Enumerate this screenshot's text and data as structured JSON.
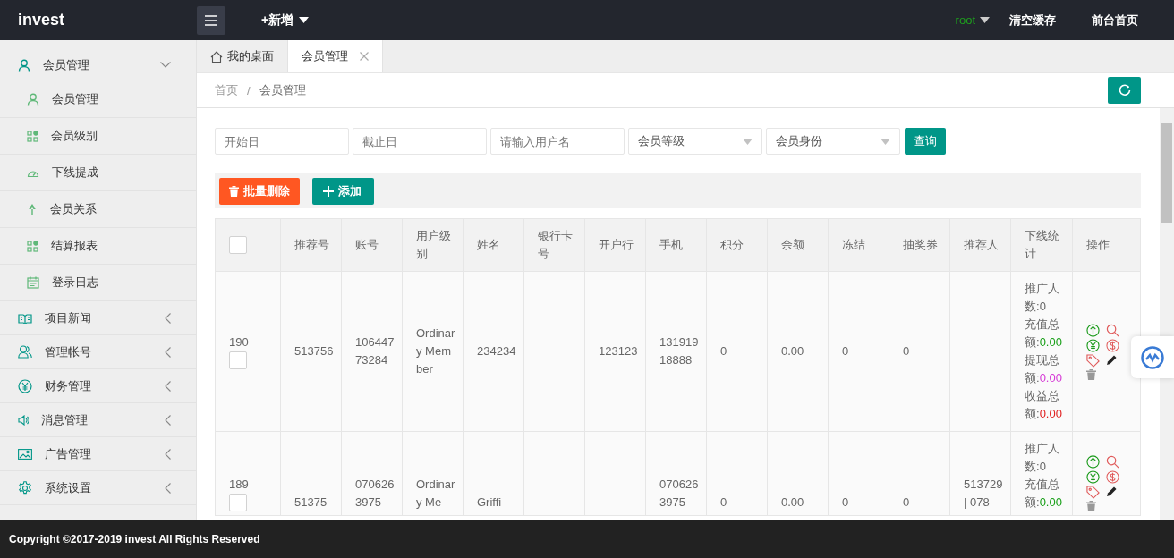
{
  "header": {
    "logo": "invest",
    "add_menu": "+新增",
    "user": "root",
    "links": [
      "清空缓存",
      "前台首页"
    ]
  },
  "sidebar": {
    "items": [
      {
        "label": "会员管理",
        "expanded": true,
        "children": [
          {
            "label": "会员管理"
          },
          {
            "label": "会员级别"
          },
          {
            "label": "下线提成"
          },
          {
            "label": "会员关系"
          },
          {
            "label": "结算报表"
          },
          {
            "label": "登录日志"
          }
        ]
      },
      {
        "label": "项目新闻",
        "expanded": false
      },
      {
        "label": "管理帐号",
        "expanded": false
      },
      {
        "label": "财务管理",
        "expanded": false
      },
      {
        "label": "消息管理",
        "expanded": false
      },
      {
        "label": "广告管理",
        "expanded": false
      },
      {
        "label": "系统设置",
        "expanded": false
      }
    ]
  },
  "tabs": [
    {
      "label": "我的桌面",
      "selected": false,
      "kind": "home"
    },
    {
      "label": "会员管理",
      "selected": true,
      "kind": "closable"
    }
  ],
  "breadcrumb": {
    "items": [
      "首页",
      "会员管理"
    ],
    "separator": "/"
  },
  "filters": [
    {
      "kind": "input",
      "placeholder": "开始日"
    },
    {
      "kind": "input",
      "placeholder": "截止日"
    },
    {
      "kind": "input",
      "placeholder": "请输入用户名"
    },
    {
      "kind": "select",
      "placeholder": "会员等级"
    },
    {
      "kind": "select",
      "placeholder": "会员身份"
    }
  ],
  "search_button": "查询",
  "toolbar": [
    {
      "kind": "danger",
      "label": "批量删除"
    },
    {
      "kind": "primary",
      "label": "添加"
    }
  ],
  "table": {
    "header_checked": false,
    "columns": [
      "推荐号",
      "账号",
      "用户级别",
      "姓名",
      "银行卡号",
      "开户行",
      "手机",
      "积分",
      "余额",
      "冻结",
      "抽奖券",
      "推荐人",
      "下线统计",
      "操作"
    ],
    "rows": [
      {
        "id": "190",
        "checked": false,
        "cells": [
          "513756",
          "10644773284",
          "Ordinary Member",
          "234234",
          null,
          "123123",
          "13191918888",
          "0",
          "0.00",
          "0",
          "0",
          null
        ],
        "stats": [
          {
            "kind": "count",
            "label": "推广人数:",
            "value": "0"
          },
          {
            "kind": "recharge",
            "label": "充值总额:",
            "value": "0.00"
          },
          {
            "kind": "withdraw",
            "label": "提现总额:",
            "value": "0.00"
          },
          {
            "kind": "income",
            "label": "收益总额:",
            "value": "0.00"
          }
        ]
      },
      {
        "id": "189",
        "checked": false,
        "cells": [
          "51375",
          "0706263975",
          "Ordinary Me",
          "Griffi",
          null,
          null,
          "0706263975",
          "0",
          "0.00",
          "0",
          "0",
          "513729 | 078"
        ],
        "stats": [
          {
            "kind": "count",
            "label": "推广人数:",
            "value": "0"
          },
          {
            "kind": "recharge",
            "label": "充值总额:",
            "value": "0.00"
          }
        ]
      }
    ]
  },
  "footer": "Copyright ©2017-2019 invest All Rights Reserved"
}
